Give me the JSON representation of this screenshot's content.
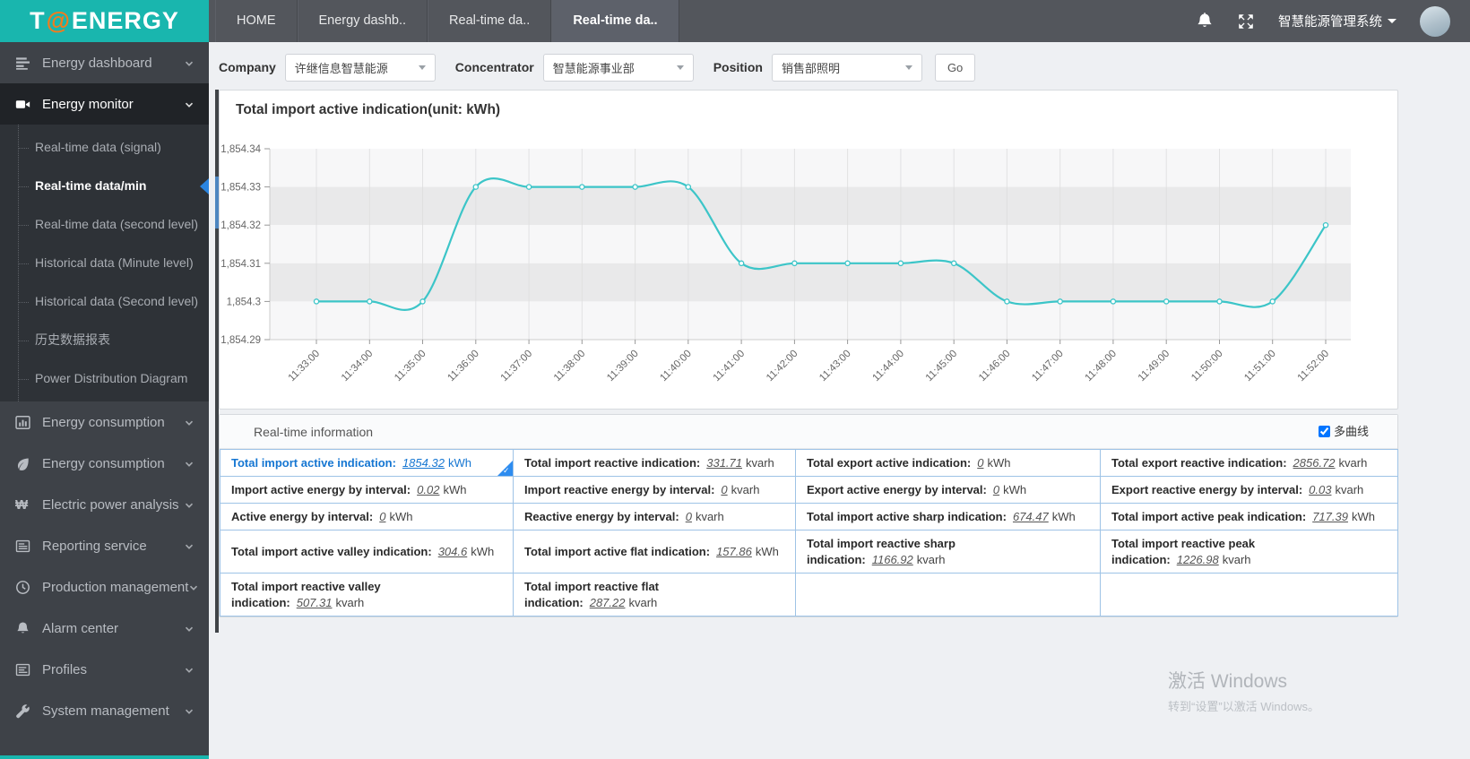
{
  "header": {
    "logo": {
      "t": "T",
      "at": "@",
      "rest": "ENERGY"
    },
    "tabs": [
      {
        "label": "HOME",
        "active": false
      },
      {
        "label": "Energy dashb..",
        "active": false
      },
      {
        "label": "Real-time da..",
        "active": false
      },
      {
        "label": "Real-time da..",
        "active": true
      }
    ],
    "system_name": "智慧能源管理系统"
  },
  "sidebar": {
    "items": [
      {
        "label": "Energy dashboard",
        "icon": "dashboard-icon"
      },
      {
        "label": "Energy monitor",
        "icon": "camera-icon",
        "active": true,
        "children": [
          {
            "label": "Real-time data (signal)"
          },
          {
            "label": "Real-time data/min",
            "active": true
          },
          {
            "label": "Real-time data (second level)"
          },
          {
            "label": "Historical data (Minute level)"
          },
          {
            "label": "Historical data (Second level)"
          },
          {
            "label": "历史数据报表"
          },
          {
            "label": "Power Distribution Diagram"
          }
        ]
      },
      {
        "label": "Energy consumption",
        "icon": "barchart-icon"
      },
      {
        "label": "Energy consumption",
        "icon": "leaf-icon"
      },
      {
        "label": "Electric power analysis",
        "icon": "won-icon"
      },
      {
        "label": "Reporting service",
        "icon": "report-icon"
      },
      {
        "label": "Production management",
        "icon": "clock-icon"
      },
      {
        "label": "Alarm center",
        "icon": "bell-icon"
      },
      {
        "label": "Profiles",
        "icon": "profiles-icon"
      },
      {
        "label": "System management",
        "icon": "wrench-icon"
      }
    ]
  },
  "toolbar": {
    "company_label": "Company",
    "company_value": "许继信息智慧能源",
    "concentrator_label": "Concentrator",
    "concentrator_value": "智慧能源事业部",
    "position_label": "Position",
    "position_value": "销售部照明",
    "go_label": "Go"
  },
  "chart_data": {
    "type": "line",
    "title": "Total import active indication(unit: kWh)",
    "x": [
      "11:33:00",
      "11:34:00",
      "11:35:00",
      "11:36:00",
      "11:37:00",
      "11:38:00",
      "11:39:00",
      "11:40:00",
      "11:41:00",
      "11:42:00",
      "11:43:00",
      "11:44:00",
      "11:45:00",
      "11:46:00",
      "11:47:00",
      "11:48:00",
      "11:49:00",
      "11:50:00",
      "11:51:00",
      "11:52:00"
    ],
    "values": [
      1854.3,
      1854.3,
      1854.3,
      1854.33,
      1854.33,
      1854.33,
      1854.33,
      1854.33,
      1854.31,
      1854.31,
      1854.31,
      1854.31,
      1854.31,
      1854.3,
      1854.3,
      1854.3,
      1854.3,
      1854.3,
      1854.3,
      1854.32
    ],
    "ylim": [
      1854.29,
      1854.34
    ],
    "yticks": [
      "1,854.34",
      "1,854.33",
      "1,854.32",
      "1,854.31",
      "1,854.3",
      "1,854.29"
    ],
    "xlabel": "",
    "ylabel": "",
    "grid": true,
    "legend": "none",
    "line_color": "#3cc5c8"
  },
  "realtime": {
    "title": "Real-time information",
    "multi_curve_label": "多曲线",
    "multi_curve_checked": true,
    "rows": [
      [
        {
          "label": "Total import active indication:",
          "value": "1854.32",
          "unit": "kWh",
          "selected": true
        },
        {
          "label": "Total import reactive indication:",
          "value": "331.71",
          "unit": "kvarh"
        },
        {
          "label": "Total export active indication:",
          "value": "0",
          "unit": "kWh"
        },
        {
          "label": "Total export reactive indication:",
          "value": "2856.72",
          "unit": "kvarh"
        }
      ],
      [
        {
          "label": "Import active energy by interval:",
          "value": "0.02",
          "unit": "kWh"
        },
        {
          "label": "Import reactive energy by interval:",
          "value": "0",
          "unit": "kvarh"
        },
        {
          "label": "Export active energy by interval:",
          "value": "0",
          "unit": "kWh"
        },
        {
          "label": "Export reactive energy by interval:",
          "value": "0.03",
          "unit": "kvarh"
        }
      ],
      [
        {
          "label": "Active energy by interval:",
          "value": "0",
          "unit": "kWh"
        },
        {
          "label": "Reactive energy by interval:",
          "value": "0",
          "unit": "kvarh"
        },
        {
          "label": "Total import active sharp indication:",
          "value": "674.47",
          "unit": "kWh"
        },
        {
          "label": "Total import active peak indication:",
          "value": "717.39",
          "unit": "kWh"
        }
      ],
      [
        {
          "label": "Total import active valley indication:",
          "value": "304.6",
          "unit": "kWh"
        },
        {
          "label": "Total import active flat indication:",
          "value": "157.86",
          "unit": "kWh"
        },
        {
          "label": "Total import reactive sharp indication:",
          "value": "1166.92",
          "unit": "kvarh"
        },
        {
          "label": "Total import reactive peak indication:",
          "value": "1226.98",
          "unit": "kvarh"
        }
      ],
      [
        {
          "label": "Total import reactive valley indication:",
          "value": "507.31",
          "unit": "kvarh"
        },
        {
          "label": "Total import reactive flat indication:",
          "value": "287.22",
          "unit": "kvarh"
        },
        {
          "empty": true
        },
        {
          "empty": true
        }
      ]
    ]
  },
  "watermark": {
    "line1": "激活 Windows",
    "line2": "转到“设置”以激活 Windows。"
  }
}
